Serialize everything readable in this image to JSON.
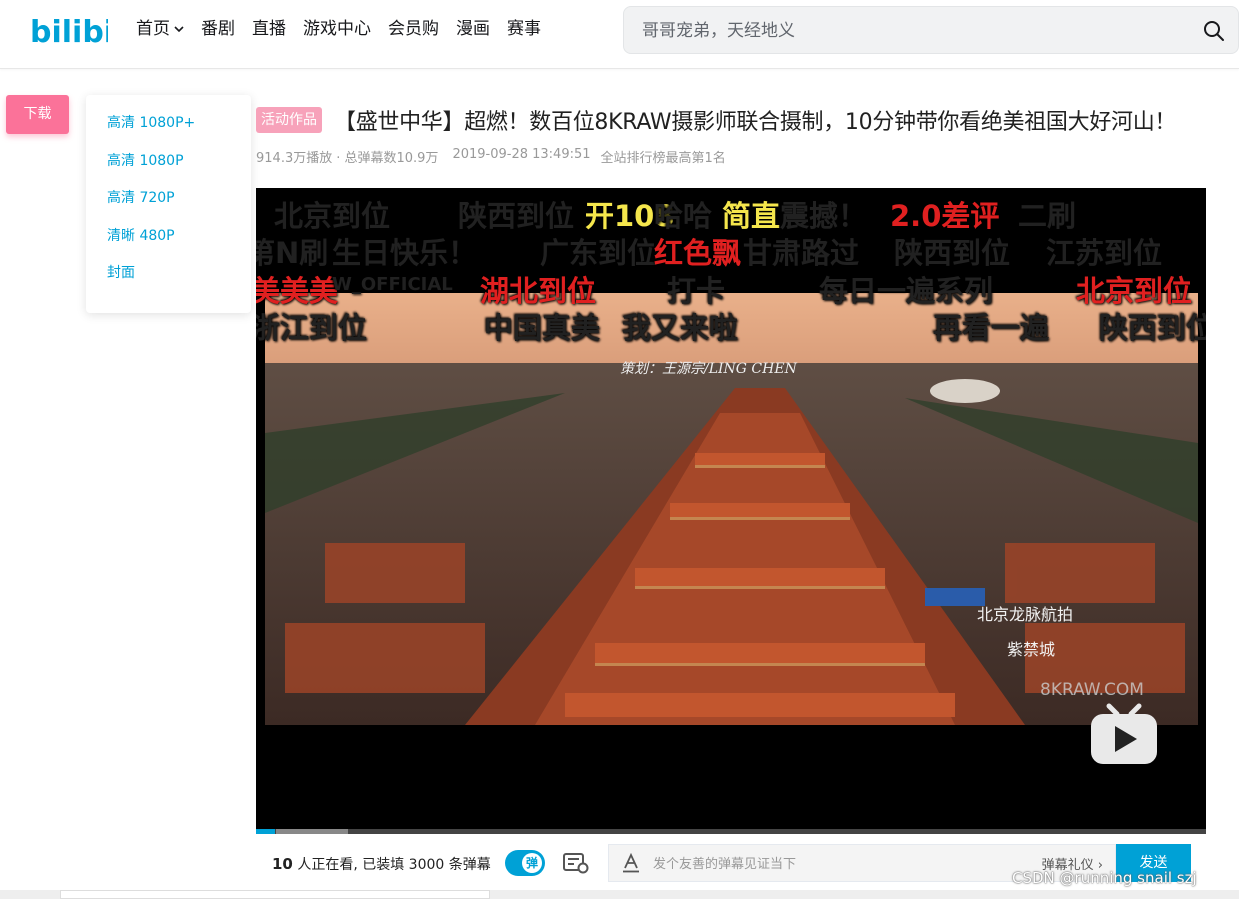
{
  "header": {
    "logo_text": "bilibili",
    "nav": [
      {
        "label": "首页",
        "has_dropdown": true
      },
      {
        "label": "番剧"
      },
      {
        "label": "直播"
      },
      {
        "label": "游戏中心"
      },
      {
        "label": "会员购"
      },
      {
        "label": "漫画"
      },
      {
        "label": "赛事"
      }
    ],
    "search": {
      "placeholder": "哥哥宠弟，天经地义",
      "icon": "search-icon"
    }
  },
  "download": {
    "button_label": "下载",
    "options": [
      "高清 1080P+",
      "高清 1080P",
      "高清 720P",
      "清晰 480P",
      "封面"
    ]
  },
  "video_info": {
    "tag": "活动作品",
    "title": "【盛世中华】超燃！数百位8KRAW摄影师联合摄制，10分钟带你看绝美祖国大好河山！",
    "plays": "914.3万播放",
    "danmaku_total": "· 总弹幕数10.9万",
    "date": "2019-09-28 13:49:51",
    "rank": "全站排行榜最高第1名"
  },
  "player": {
    "danmaku": [
      {
        "text": "北京到位",
        "color": "#ffffff"
      },
      {
        "text": "陕西到位",
        "color": "#ffffff"
      },
      {
        "text": "开108",
        "color": "#f5e64c"
      },
      {
        "text": "哈哈",
        "color": "#ffffff"
      },
      {
        "text": "简直",
        "color": "#f5e64c"
      },
      {
        "text": "震撼！",
        "color": "#ffffff"
      },
      {
        "text": "2.0差评",
        "color": "#e02020"
      },
      {
        "text": "二刷",
        "color": "#ffffff"
      },
      {
        "text": "第N刷",
        "color": "#ffffff"
      },
      {
        "text": "生日快乐！",
        "color": "#ffffff"
      },
      {
        "text": "广东到位",
        "color": "#ffffff"
      },
      {
        "text": "红色飘",
        "color": "#e02020"
      },
      {
        "text": "甘肃路过",
        "color": "#ffffff"
      },
      {
        "text": "陕西到位",
        "color": "#ffffff"
      },
      {
        "text": "江苏到位",
        "color": "#ffffff"
      },
      {
        "text": "美美美",
        "color": "#e02020"
      },
      {
        "text": "W_OFFICIAL",
        "color": "#ffffff"
      },
      {
        "text": "湖北到位",
        "color": "#e02020"
      },
      {
        "text": "打卡",
        "color": "#ffffff"
      },
      {
        "text": "每日一遍系列",
        "color": "#ffffff"
      },
      {
        "text": "北京到位",
        "color": "#e02020"
      },
      {
        "text": "浙江到位",
        "color": "#ffffff"
      },
      {
        "text": "中国真美",
        "color": "#ffffff"
      },
      {
        "text": "我又来啦",
        "color": "#ffffff"
      },
      {
        "text": "再看一遍",
        "color": "#ffffff"
      },
      {
        "text": "陕西到位",
        "color": "#ffffff"
      }
    ],
    "video_overlay": {
      "credit": "策划：王源宗/LING CHEN",
      "location": "北京龙脉航拍",
      "place": "紫禁城",
      "watermark": "8KRAW.COM"
    },
    "progress_fraction": 0.02
  },
  "controls": {
    "viewer_count": "10",
    "viewer_text": " 人正在看, 已装填 3000 条弹幕",
    "toggle_label": "弹",
    "danmaku_placeholder": "发个友善的弹幕见证当下",
    "etiquette": "弹幕礼仪 ›",
    "send_label": "发送"
  },
  "page_watermark": "CSDN @running snail szj",
  "colors": {
    "brand_blue": "#00a1d6",
    "brand_pink": "#fb7299",
    "tag_pink": "#f7a2ba"
  }
}
